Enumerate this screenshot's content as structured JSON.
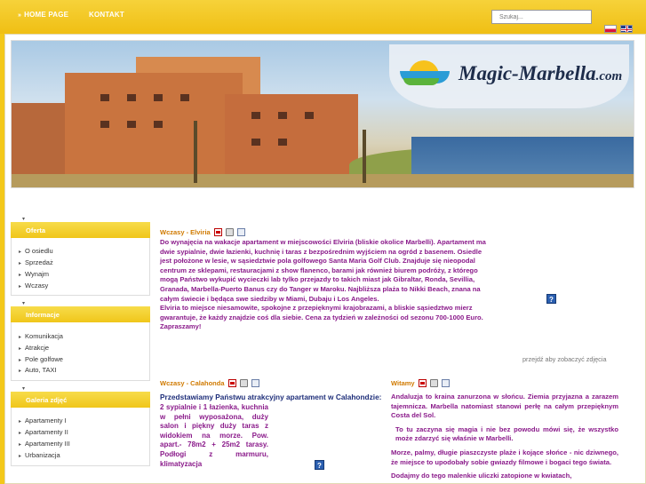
{
  "nav": {
    "home_label": "HOME PAGE",
    "home_arrow": "»",
    "contact_label": "KONTAKT"
  },
  "search": {
    "placeholder": "Szukaj..."
  },
  "banner": {
    "logo_main": "Magic-Marbella",
    "logo_tld": ".com"
  },
  "sidebar": {
    "sections": [
      {
        "title": "Oferta",
        "items": [
          "O osiedlu",
          "Sprzedaż",
          "Wynajm",
          "Wczasy"
        ]
      },
      {
        "title": "Informacje",
        "items": [
          "Komunikacja",
          "Atrakcje",
          "Pole golfowe",
          "Auto, TAXI"
        ]
      },
      {
        "title": "Galeria zdjęć",
        "items": [
          "Apartamenty I",
          "Apartamenty II",
          "Apartamenty III",
          "Urbanizacja"
        ]
      }
    ]
  },
  "articles": {
    "elviria": {
      "title": "Wczasy - Elviria",
      "paragraphs": [
        "Do wynajęcia na wakacje apartament w miejscowości Elviria (bliskie okolice Marbelli). Apartament ma dwie sypialnie, dwie łazienki, kuchnię i taras z bezpośrednim wyjściem na ogród z basenem. Osiedle jest położone w lesie, w sąsiedztwie pola golfowego Santa Maria Golf Club. Znajduje się nieopodal centrum ze sklepami, restauracjami z show flanenco, barami jak również biurem podróży, z którego mogą Państwo wykupić wycieczki lab tylko przejazdy to takich miast jak Gibraltar, Ronda, Sevillia, Granada, Marbella-Puerto Banus czy do Tanger w Maroku. Najbliższa plaża to Nikki Beach, znana na całym świecie i będąca swe siedziby w Miami, Dubaju i Los Angeles.",
        "Elviria to miejsce niesamowite, spokojne z przepięknymi krajobrazami, a bliskie sąsiedztwo mierz gwarantuje, że każdy znajdzie coś dla siebie. Cena za tydzień w zależności od sezonu 700-1000 Euro. Zapraszamy!"
      ],
      "see_photos": "przejdź aby zobaczyć zdjęcia"
    },
    "calahonda": {
      "title": "Wczasy - Calahonda",
      "text_part1": "Przedstawiamy Państwu atrakcyjny apartament w Calahondzie:",
      "text_part2": "2 sypialnie i 1 łazienka, kuchnia w pełni wyposażona, duży salon i piękny duży taras z widokiem na morze. Pow. apart.- 78m2 + 25m2 tarasy. Podłogi z marmuru, klimatyzacja"
    },
    "witamy": {
      "title": "Witamy",
      "paragraphs": [
        "Andaluzja to kraina zanurzona w słońcu. Ziemia przyjazna a zarazem tajemnicza. Marbella natomiast stanowi perłę na całym przepięknym Costa del Sol.",
        "To tu zaczyna się magia i nie bez powodu mówi się, że wszystko może zdarzyć się właśnie w Marbelli.",
        "Morze, palmy, długie piaszczyste plaże i kojące słońce - nic dziwnego, że miejsce to upodobały sobie gwiazdy filmowe i bogaci tego świata.",
        "Dodajmy do tego malenkie uliczki zatopione w kwiatach,"
      ]
    }
  },
  "colors": {
    "accent_yellow": "#f0c61a",
    "title_orange": "#d07a00",
    "text_purple": "#8a1a8a"
  }
}
